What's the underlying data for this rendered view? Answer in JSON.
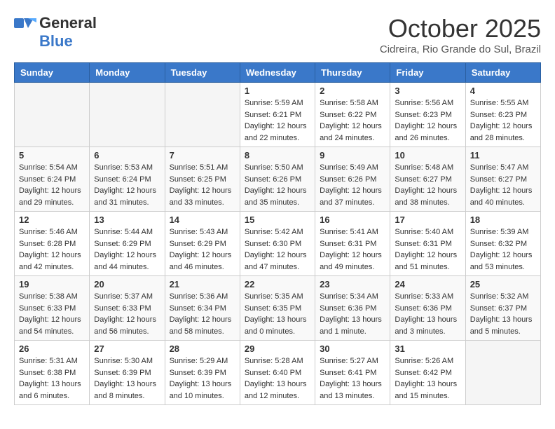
{
  "logo": {
    "general": "General",
    "blue": "Blue"
  },
  "title": {
    "month": "October 2025",
    "location": "Cidreira, Rio Grande do Sul, Brazil"
  },
  "days_of_week": [
    "Sunday",
    "Monday",
    "Tuesday",
    "Wednesday",
    "Thursday",
    "Friday",
    "Saturday"
  ],
  "weeks": [
    [
      {
        "day": null,
        "info": null
      },
      {
        "day": null,
        "info": null
      },
      {
        "day": null,
        "info": null
      },
      {
        "day": "1",
        "info": "Sunrise: 5:59 AM\nSunset: 6:21 PM\nDaylight: 12 hours\nand 22 minutes."
      },
      {
        "day": "2",
        "info": "Sunrise: 5:58 AM\nSunset: 6:22 PM\nDaylight: 12 hours\nand 24 minutes."
      },
      {
        "day": "3",
        "info": "Sunrise: 5:56 AM\nSunset: 6:23 PM\nDaylight: 12 hours\nand 26 minutes."
      },
      {
        "day": "4",
        "info": "Sunrise: 5:55 AM\nSunset: 6:23 PM\nDaylight: 12 hours\nand 28 minutes."
      }
    ],
    [
      {
        "day": "5",
        "info": "Sunrise: 5:54 AM\nSunset: 6:24 PM\nDaylight: 12 hours\nand 29 minutes."
      },
      {
        "day": "6",
        "info": "Sunrise: 5:53 AM\nSunset: 6:24 PM\nDaylight: 12 hours\nand 31 minutes."
      },
      {
        "day": "7",
        "info": "Sunrise: 5:51 AM\nSunset: 6:25 PM\nDaylight: 12 hours\nand 33 minutes."
      },
      {
        "day": "8",
        "info": "Sunrise: 5:50 AM\nSunset: 6:26 PM\nDaylight: 12 hours\nand 35 minutes."
      },
      {
        "day": "9",
        "info": "Sunrise: 5:49 AM\nSunset: 6:26 PM\nDaylight: 12 hours\nand 37 minutes."
      },
      {
        "day": "10",
        "info": "Sunrise: 5:48 AM\nSunset: 6:27 PM\nDaylight: 12 hours\nand 38 minutes."
      },
      {
        "day": "11",
        "info": "Sunrise: 5:47 AM\nSunset: 6:27 PM\nDaylight: 12 hours\nand 40 minutes."
      }
    ],
    [
      {
        "day": "12",
        "info": "Sunrise: 5:46 AM\nSunset: 6:28 PM\nDaylight: 12 hours\nand 42 minutes."
      },
      {
        "day": "13",
        "info": "Sunrise: 5:44 AM\nSunset: 6:29 PM\nDaylight: 12 hours\nand 44 minutes."
      },
      {
        "day": "14",
        "info": "Sunrise: 5:43 AM\nSunset: 6:29 PM\nDaylight: 12 hours\nand 46 minutes."
      },
      {
        "day": "15",
        "info": "Sunrise: 5:42 AM\nSunset: 6:30 PM\nDaylight: 12 hours\nand 47 minutes."
      },
      {
        "day": "16",
        "info": "Sunrise: 5:41 AM\nSunset: 6:31 PM\nDaylight: 12 hours\nand 49 minutes."
      },
      {
        "day": "17",
        "info": "Sunrise: 5:40 AM\nSunset: 6:31 PM\nDaylight: 12 hours\nand 51 minutes."
      },
      {
        "day": "18",
        "info": "Sunrise: 5:39 AM\nSunset: 6:32 PM\nDaylight: 12 hours\nand 53 minutes."
      }
    ],
    [
      {
        "day": "19",
        "info": "Sunrise: 5:38 AM\nSunset: 6:33 PM\nDaylight: 12 hours\nand 54 minutes."
      },
      {
        "day": "20",
        "info": "Sunrise: 5:37 AM\nSunset: 6:33 PM\nDaylight: 12 hours\nand 56 minutes."
      },
      {
        "day": "21",
        "info": "Sunrise: 5:36 AM\nSunset: 6:34 PM\nDaylight: 12 hours\nand 58 minutes."
      },
      {
        "day": "22",
        "info": "Sunrise: 5:35 AM\nSunset: 6:35 PM\nDaylight: 13 hours\nand 0 minutes."
      },
      {
        "day": "23",
        "info": "Sunrise: 5:34 AM\nSunset: 6:36 PM\nDaylight: 13 hours\nand 1 minute."
      },
      {
        "day": "24",
        "info": "Sunrise: 5:33 AM\nSunset: 6:36 PM\nDaylight: 13 hours\nand 3 minutes."
      },
      {
        "day": "25",
        "info": "Sunrise: 5:32 AM\nSunset: 6:37 PM\nDaylight: 13 hours\nand 5 minutes."
      }
    ],
    [
      {
        "day": "26",
        "info": "Sunrise: 5:31 AM\nSunset: 6:38 PM\nDaylight: 13 hours\nand 6 minutes."
      },
      {
        "day": "27",
        "info": "Sunrise: 5:30 AM\nSunset: 6:39 PM\nDaylight: 13 hours\nand 8 minutes."
      },
      {
        "day": "28",
        "info": "Sunrise: 5:29 AM\nSunset: 6:39 PM\nDaylight: 13 hours\nand 10 minutes."
      },
      {
        "day": "29",
        "info": "Sunrise: 5:28 AM\nSunset: 6:40 PM\nDaylight: 13 hours\nand 12 minutes."
      },
      {
        "day": "30",
        "info": "Sunrise: 5:27 AM\nSunset: 6:41 PM\nDaylight: 13 hours\nand 13 minutes."
      },
      {
        "day": "31",
        "info": "Sunrise: 5:26 AM\nSunset: 6:42 PM\nDaylight: 13 hours\nand 15 minutes."
      },
      {
        "day": null,
        "info": null
      }
    ]
  ]
}
